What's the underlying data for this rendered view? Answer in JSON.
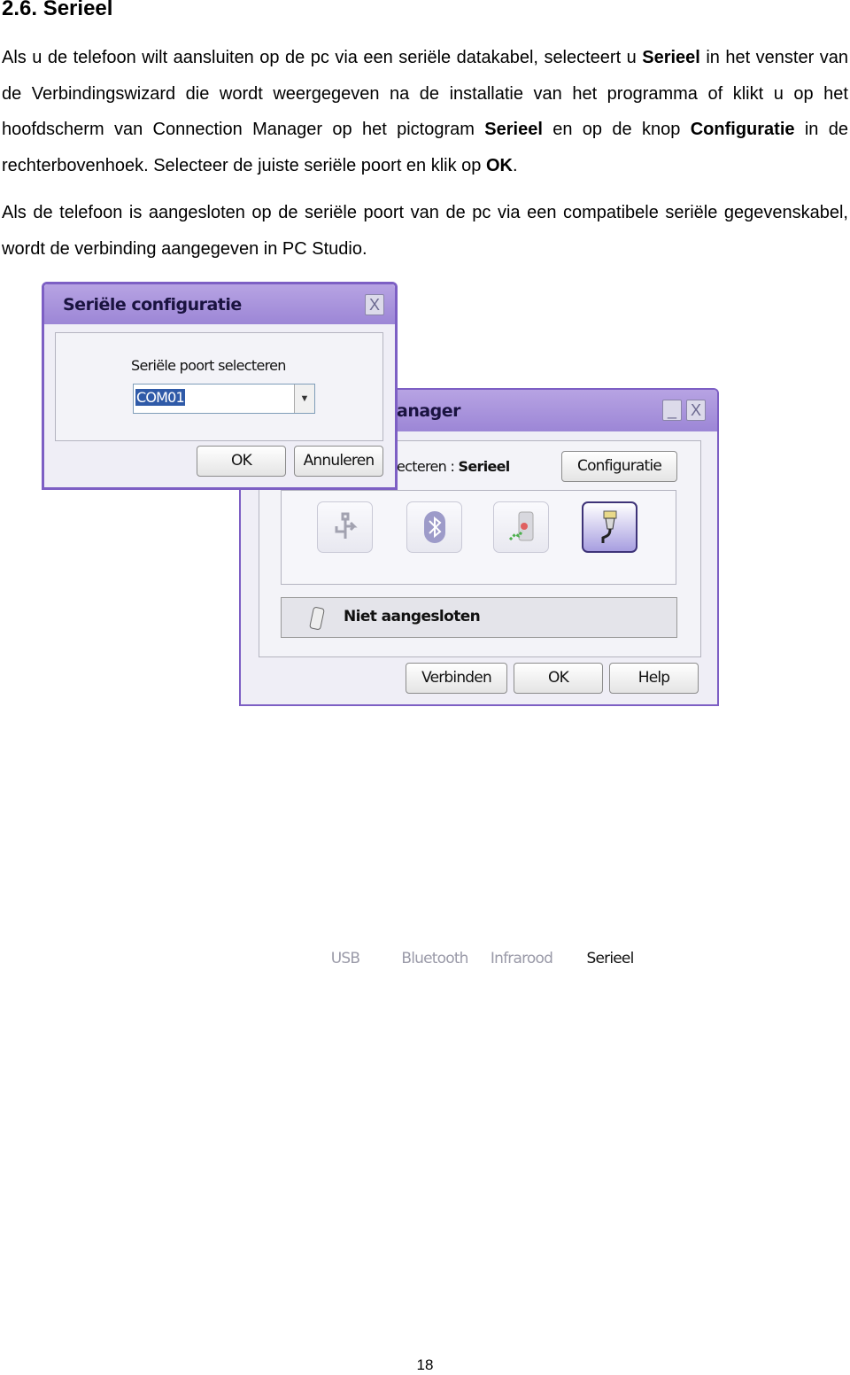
{
  "heading": "2.6. Serieel",
  "para1": {
    "t1": "Als u de telefoon wilt aansluiten op de pc via een seriële datakabel, selecteert u ",
    "b1": "Serieel",
    "t2": " in het venster van de Verbindingswizard die wordt weergegeven na de installatie van het programma of klikt u op het hoofdscherm van Connection Manager op het pictogram ",
    "b2": "Serieel",
    "t3": " en op de knop ",
    "b3": "Configuratie",
    "t4": " in de rechterbovenhoek. Selecteer de juiste seriële poort en klik op ",
    "b4": "OK",
    "t5": "."
  },
  "para2": "Als de telefoon is aangesloten op de seriële poort van de pc via een compatibele seriële gegevenskabel, wordt de verbinding aangegeven in PC Studio.",
  "serial_dialog": {
    "title": "Seriële configuratie",
    "close": "X",
    "port_label": "Seriële poort selecteren",
    "port_value": "COM01",
    "ok": "OK",
    "cancel": "Annuleren"
  },
  "manager_window": {
    "title_visible": "anager",
    "minimize": "_",
    "close": "X",
    "select_label_visible": "ecteren : ",
    "selected_mode": "Serieel",
    "config_button": "Configuratie",
    "modes": [
      "USB",
      "Bluetooth",
      "Infrarood",
      "Serieel"
    ],
    "active_mode": "Serieel",
    "status": "Niet aangesloten",
    "connect": "Verbinden",
    "ok": "OK",
    "help": "Help"
  },
  "page_number": "18",
  "colors": {
    "window_border": "#7d5fc4",
    "title_bar": "#a994dc",
    "selection": "#2f5aa8"
  }
}
